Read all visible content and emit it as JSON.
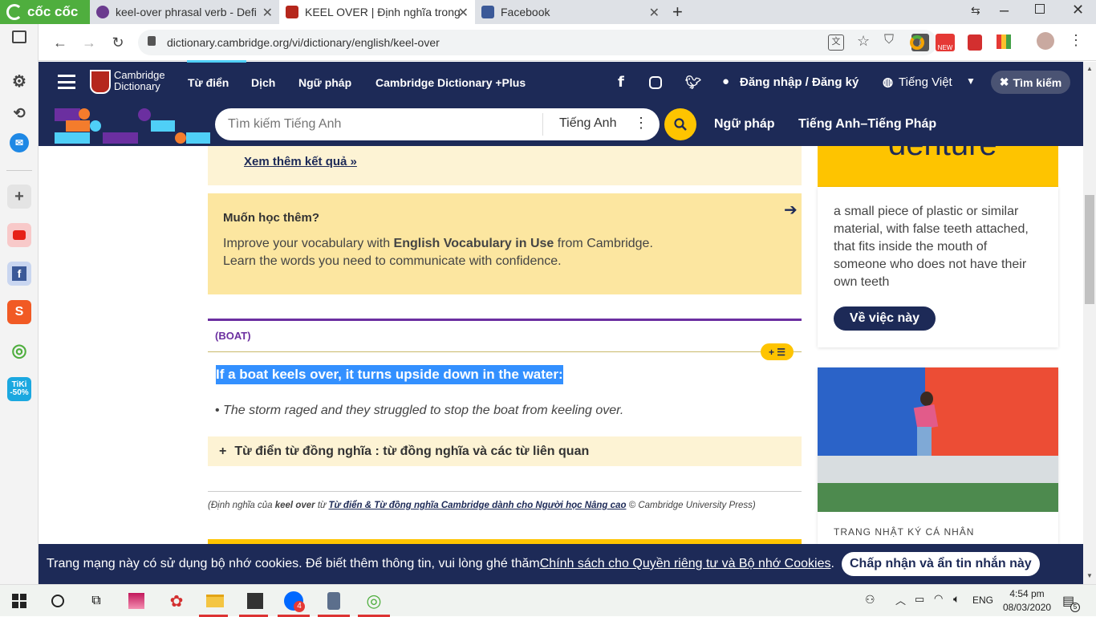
{
  "browser": {
    "brand": "cốc cốc",
    "tabs": [
      {
        "title": "keel-over phrasal verb - Defi",
        "active": false
      },
      {
        "title": "KEEL OVER | Định nghĩa trong",
        "active": true
      },
      {
        "title": "Facebook",
        "active": false
      }
    ],
    "new_tab": "+",
    "url": "dictionary.cambridge.org/vi/dictionary/english/keel-over"
  },
  "sidebar": {
    "add": "+",
    "tiki_line1": "TiKi",
    "tiki_line2": "-50%"
  },
  "site": {
    "logo_line1": "Cambridge",
    "logo_line2": "Dictionary",
    "nav": [
      "Từ điển",
      "Dịch",
      "Ngữ pháp",
      "Cambridge Dictionary +Plus"
    ],
    "login": "Đăng nhập / Đăng ký",
    "language": "Tiếng Việt",
    "search_button": "Tìm kiếm",
    "search_placeholder": "Tìm kiếm Tiếng Anh",
    "search_lang": "Tiếng Anh",
    "nav2": [
      "Ngữ pháp",
      "Tiếng Anh–Tiếng Pháp"
    ]
  },
  "main": {
    "see_more": "Xem thêm kết quả »",
    "promo_title": "Muốn học thêm?",
    "promo_line1_a": "Improve your vocabulary with ",
    "promo_line1_b": "English Vocabulary in Use",
    "promo_line1_c": " from Cambridge.",
    "promo_line2": "Learn the words you need to communicate with confidence.",
    "guide": "(BOAT)",
    "list_button": "+ ☰",
    "definition": "If a boat keels over, it turns upside down in the water:",
    "example": "The storm raged and they struggled to stop the boat from keeling over.",
    "thesaurus": "Từ điển từ đồng nghĩa : từ đồng nghĩa và các từ liên quan",
    "credit_a": "(Định nghĩa của ",
    "credit_b": "keel over",
    "credit_c": " từ ",
    "credit_link": "Từ điển & Từ đồng nghĩa Cambridge dành cho Người học Nâng cao",
    "credit_d": " © Cambridge University Press)"
  },
  "aside": {
    "word": "denture",
    "definition": "a small piece of plastic or similar material, with false teeth attached, that fits inside the mouth of someone who does not have their own teeth",
    "about_button": "Về việc này",
    "blog_label": "TRANG NHẬT KÝ CÁ NHÂN"
  },
  "cookie": {
    "text": "Trang mạng này có sử dụng bộ nhớ cookies. Để biết thêm thông tin, vui lòng ghé thăm ",
    "link": "Chính sách cho Quyền riêng tư và Bộ nhớ Cookies",
    "period": ".",
    "accept": "Chấp nhận và ẩn tin nhắn này"
  },
  "taskbar": {
    "zalo_badge": "4",
    "lang": "ENG",
    "time": "4:54 pm",
    "date": "08/03/2020",
    "notif": "5"
  },
  "colors": {
    "brand_navy": "#1d2a57",
    "accent_yellow": "#fec400",
    "card_yellow": "#fce6a0",
    "selection": "#3390ff",
    "guide_purple": "#6b2fa0"
  }
}
